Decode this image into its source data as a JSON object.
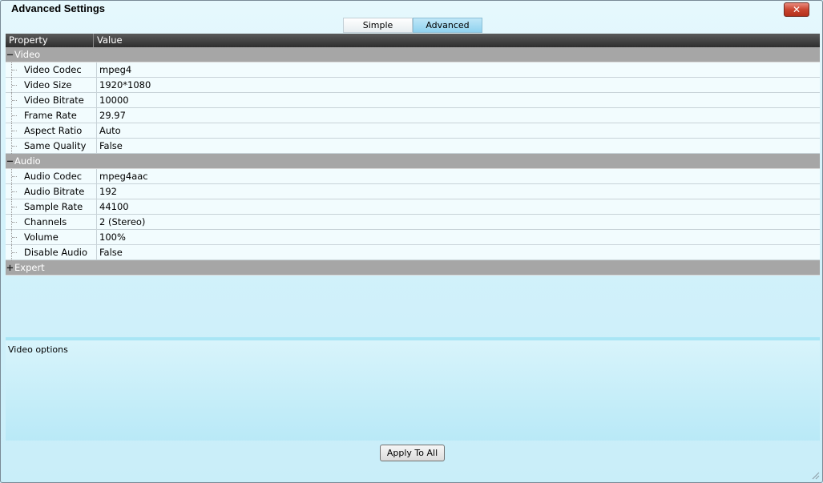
{
  "window": {
    "title": "Advanced Settings",
    "close_label": "✕"
  },
  "tabs": [
    {
      "label": "Simple"
    },
    {
      "label": "Advanced"
    }
  ],
  "grid": {
    "columns": [
      "Property",
      "Value"
    ],
    "categories": [
      {
        "name": "Video",
        "sign": "−",
        "rows": [
          {
            "property": "Video Codec",
            "value": "mpeg4"
          },
          {
            "property": "Video Size",
            "value": "1920*1080"
          },
          {
            "property": "Video Bitrate",
            "value": "10000"
          },
          {
            "property": "Frame Rate",
            "value": "29.97"
          },
          {
            "property": "Aspect Ratio",
            "value": "Auto"
          },
          {
            "property": "Same Quality",
            "value": "False"
          }
        ]
      },
      {
        "name": "Audio",
        "sign": "−",
        "rows": [
          {
            "property": "Audio Codec",
            "value": "mpeg4aac"
          },
          {
            "property": "Audio Bitrate",
            "value": "192"
          },
          {
            "property": "Sample Rate",
            "value": "44100"
          },
          {
            "property": "Channels",
            "value": "2 (Stereo)"
          },
          {
            "property": "Volume",
            "value": "100%"
          },
          {
            "property": "Disable Audio",
            "value": "False"
          }
        ]
      },
      {
        "name": "Expert",
        "sign": "+",
        "rows": []
      }
    ]
  },
  "description": {
    "text": "Video options"
  },
  "apply_button": {
    "label": "Apply To All"
  }
}
